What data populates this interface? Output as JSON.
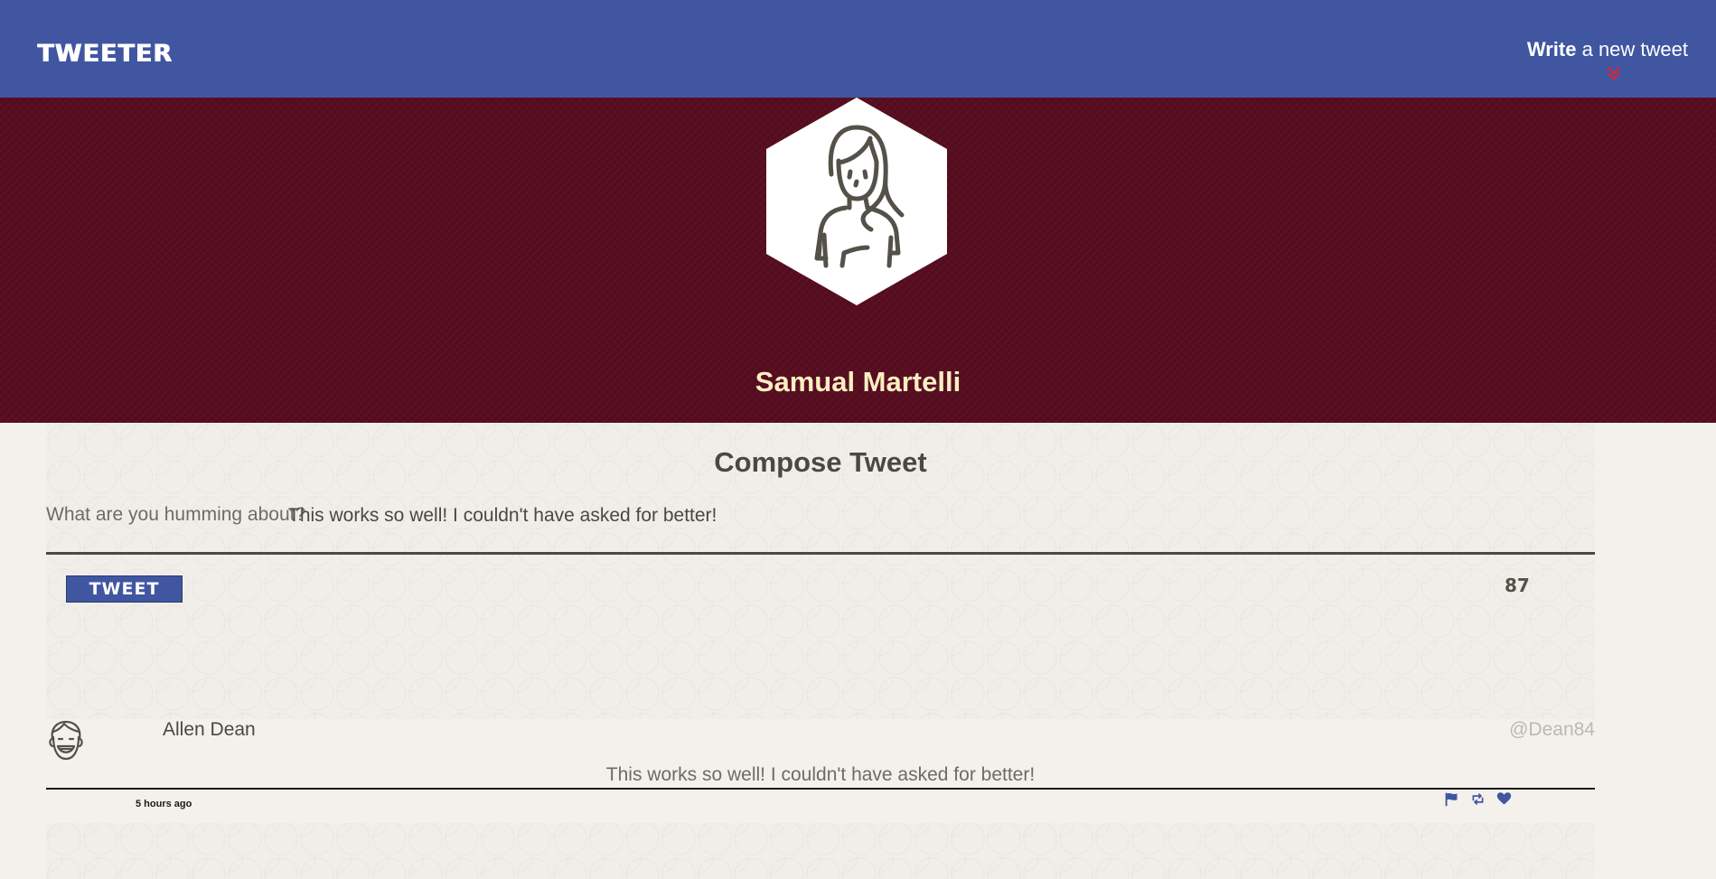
{
  "nav": {
    "brand": "TWEETER",
    "write_bold": "Write",
    "write_rest": " a new tweet",
    "chevron_icon": "double-chevron-down-icon",
    "accent": "#e0232d"
  },
  "profile": {
    "name": "Samual Martelli",
    "avatar_icon": "woman-avatar-icon",
    "bg_color": "#570d20",
    "name_color": "#fbeec1"
  },
  "compose": {
    "title": "Compose Tweet",
    "label": "What are you humming about?",
    "text_value": "This works so well! I couldn't have asked for better!",
    "button_label": "TWEET",
    "counter": "87"
  },
  "tweet": {
    "author": "Allen Dean",
    "handle": "@Dean84",
    "content": "This works so well! I couldn't have asked for better!",
    "time": "5 hours ago",
    "avatar_icon": "smiling-man-avatar-icon",
    "actions": [
      {
        "icon": "flag-icon"
      },
      {
        "icon": "retweet-icon"
      },
      {
        "icon": "heart-icon"
      }
    ]
  },
  "colors": {
    "nav_bg": "#4056a1",
    "icon_blue": "#4056a1",
    "text_dark": "#4a4744"
  }
}
